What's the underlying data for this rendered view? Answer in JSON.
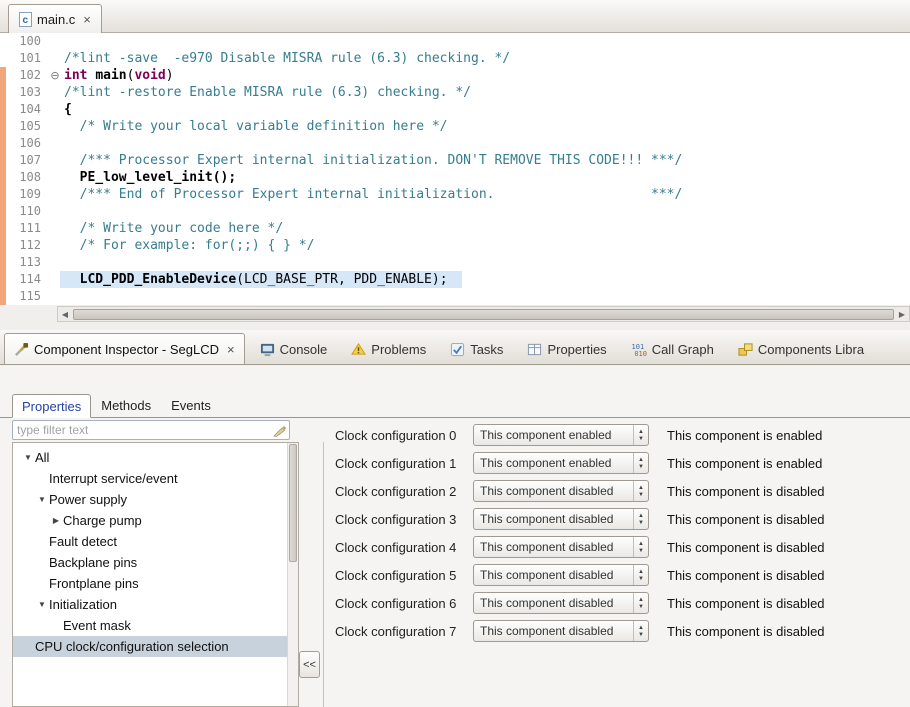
{
  "editor": {
    "tab_label": "main.c",
    "lines": [
      {
        "n": "100",
        "segs": []
      },
      {
        "n": "101",
        "segs": [
          {
            "s": "c",
            "t": "/*lint -save  -e970 Disable MISRA rule (6.3) checking. */"
          }
        ]
      },
      {
        "n": "102",
        "chg": true,
        "fold": true,
        "segs": [
          {
            "s": "k",
            "t": "int"
          },
          {
            "s": "p",
            "t": " "
          },
          {
            "s": "f",
            "t": "main"
          },
          {
            "s": "p",
            "t": "("
          },
          {
            "s": "k",
            "t": "void"
          },
          {
            "s": "p",
            "t": ")"
          }
        ]
      },
      {
        "n": "103",
        "chg": true,
        "segs": [
          {
            "s": "c",
            "t": "/*lint -restore Enable MISRA rule (6.3) checking. */"
          }
        ]
      },
      {
        "n": "104",
        "chg": true,
        "segs": [
          {
            "s": "f",
            "t": "{"
          }
        ]
      },
      {
        "n": "105",
        "chg": true,
        "segs": [
          {
            "s": "c",
            "t": "  /* Write your local variable definition here */"
          }
        ]
      },
      {
        "n": "106",
        "chg": true,
        "segs": []
      },
      {
        "n": "107",
        "chg": true,
        "segs": [
          {
            "s": "c",
            "t": "  /*** Processor Expert internal initialization. DON'T REMOVE THIS CODE!!! ***/"
          }
        ]
      },
      {
        "n": "108",
        "chg": true,
        "segs": [
          {
            "s": "f",
            "t": "  PE_low_level_init();"
          }
        ]
      },
      {
        "n": "109",
        "chg": true,
        "segs": [
          {
            "s": "c",
            "t": "  /*** End of Processor Expert internal initialization.                    ***/"
          }
        ]
      },
      {
        "n": "110",
        "chg": true,
        "segs": []
      },
      {
        "n": "111",
        "chg": true,
        "segs": [
          {
            "s": "c",
            "t": "  /* Write your code here */"
          }
        ]
      },
      {
        "n": "112",
        "chg": true,
        "segs": [
          {
            "s": "c",
            "t": "  /* For example: for(;;) { } */"
          }
        ]
      },
      {
        "n": "113",
        "chg": true,
        "segs": []
      },
      {
        "n": "114",
        "chg": true,
        "hl": true,
        "segs": [
          {
            "s": "p",
            "t": "  "
          },
          {
            "s": "f",
            "t": "LCD_PDD_EnableDevice"
          },
          {
            "s": "p",
            "t": "(LCD_BASE_PTR, PDD_ENABLE);"
          }
        ]
      },
      {
        "n": "115",
        "chg": true,
        "segs": []
      }
    ]
  },
  "icons": {
    "close": "×",
    "fold_collapse": "⊖",
    "scroll_left": "◀",
    "scroll_right": "▶",
    "tree_expanded": "▼",
    "tree_collapsed": "▶",
    "spinner_up": "▲",
    "spinner_down": "▼"
  },
  "view_tabs": [
    {
      "label": "Component Inspector - SegLCD",
      "icon": "component-inspector-icon",
      "active": true
    },
    {
      "label": "Console",
      "icon": "console-icon"
    },
    {
      "label": "Problems",
      "icon": "problems-icon"
    },
    {
      "label": "Tasks",
      "icon": "tasks-icon"
    },
    {
      "label": "Properties",
      "icon": "properties-icon"
    },
    {
      "label": "Call Graph",
      "icon": "call-graph-icon"
    },
    {
      "label": "Components Libra",
      "icon": "components-library-icon"
    }
  ],
  "inspector": {
    "tabs": [
      {
        "label": "Properties",
        "active": true
      },
      {
        "label": "Methods"
      },
      {
        "label": "Events"
      }
    ],
    "filter_placeholder": "type filter text",
    "collapse_label": "<<",
    "tree": [
      {
        "label": "All",
        "indent": 0,
        "expand": "open"
      },
      {
        "label": "Interrupt service/event",
        "indent": 1
      },
      {
        "label": "Power supply",
        "indent": 1,
        "expand": "open"
      },
      {
        "label": "Charge pump",
        "indent": 2,
        "expand": "closed"
      },
      {
        "label": "Fault detect",
        "indent": 1
      },
      {
        "label": "Backplane pins",
        "indent": 1
      },
      {
        "label": "Frontplane pins",
        "indent": 1
      },
      {
        "label": "Initialization",
        "indent": 1,
        "expand": "open"
      },
      {
        "label": "Event mask",
        "indent": 2
      },
      {
        "label": "CPU clock/configuration selection",
        "indent": 0,
        "selected": true
      }
    ],
    "rows": [
      {
        "label": "Clock configuration 0",
        "value": "This component enabled",
        "status": "This component is enabled"
      },
      {
        "label": "Clock configuration 1",
        "value": "This component enabled",
        "status": "This component is enabled"
      },
      {
        "label": "Clock configuration 2",
        "value": "This component disabled",
        "status": "This component is disabled"
      },
      {
        "label": "Clock configuration 3",
        "value": "This component disabled",
        "status": "This component is disabled"
      },
      {
        "label": "Clock configuration 4",
        "value": "This component disabled",
        "status": "This component is disabled"
      },
      {
        "label": "Clock configuration 5",
        "value": "This component disabled",
        "status": "This component is disabled"
      },
      {
        "label": "Clock configuration 6",
        "value": "This component disabled",
        "status": "This component is disabled"
      },
      {
        "label": "Clock configuration 7",
        "value": "This component disabled",
        "status": "This component is disabled"
      }
    ]
  },
  "colors": {
    "comment": "#367d8f",
    "keyword": "#7f0055",
    "plain": "#000000",
    "line_highlight": "#d6e8f7",
    "change_bar": "#f2a67c",
    "selected_tree_row": "#c8d2dc",
    "active_tab_text": "#2643a0"
  }
}
